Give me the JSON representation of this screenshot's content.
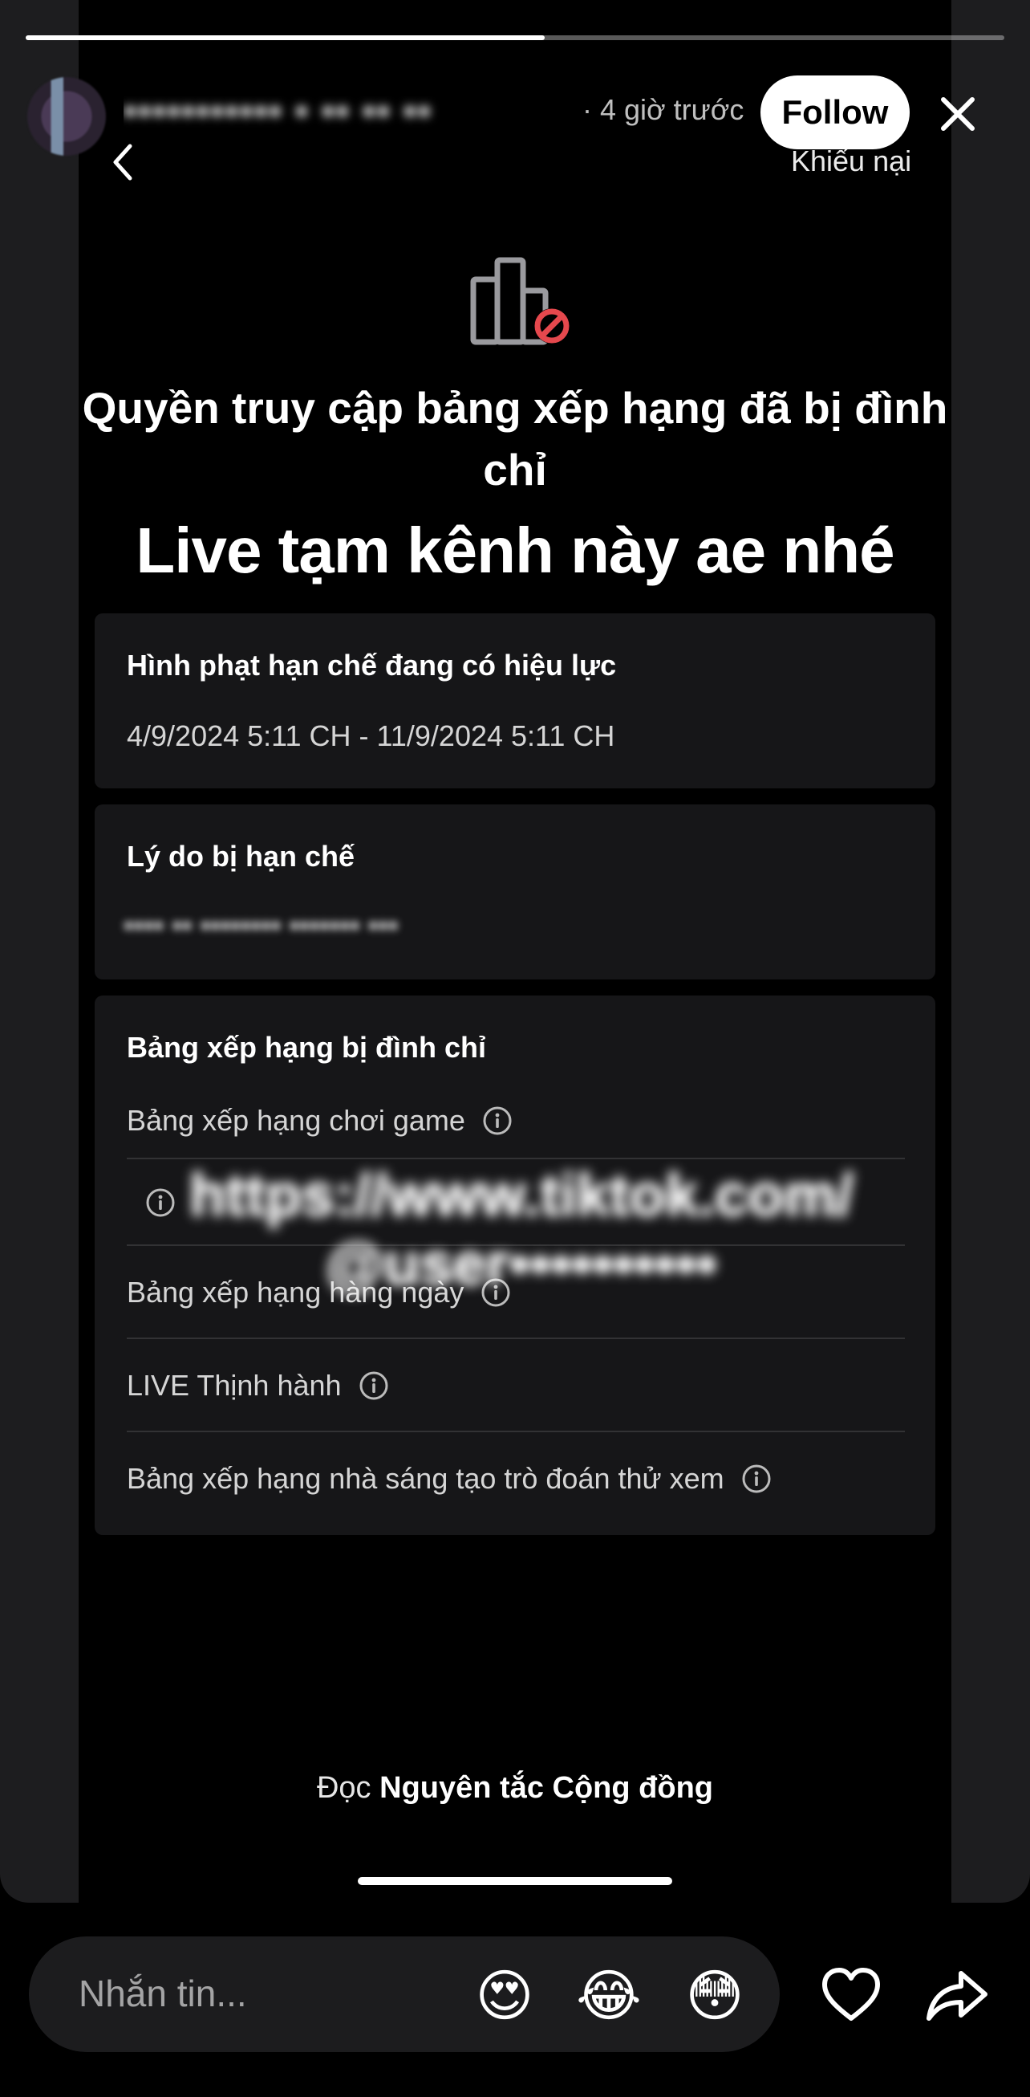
{
  "story": {
    "progress": 0.53,
    "username": "••••••••••• • •• •• ••",
    "time_ago": "· 4 giờ trước",
    "follow_label": "Follow",
    "close_icon": "close-icon"
  },
  "screenshot": {
    "back_icon": "chevron-left-icon",
    "report_label": "Khiếu nại",
    "icon": "leaderboard-banned-icon",
    "headline": "Quyền truy cập bảng xếp hạng đã bị đình chỉ",
    "overlay_text": "Live tạm kênh này ae nhé",
    "penalty": {
      "title": "Hình phạt hạn chế đang có hiệu lực",
      "dates": "4/9/2024 5:11 CH - 11/9/2024 5:11 CH"
    },
    "reason": {
      "title": "Lý do bị hạn chế",
      "text": "•••• •• •••••••• ••••••• •••"
    },
    "suspended": {
      "title": "Bảng xếp hạng bị đình chỉ",
      "items": [
        "Bảng xếp hạng chơi game",
        "",
        "Bảng xếp hạng hàng ngày",
        "LIVE Thịnh hành",
        "Bảng xếp hạng nhà sáng tạo trò đoán thử xem"
      ]
    },
    "sticker_text": [
      "https://www.tiktok.com/",
      "@user••••••••••"
    ],
    "guidelines_prefix": "Đọc",
    "guidelines_link": "Nguyên tắc Cộng đồng"
  },
  "bottom_bar": {
    "message_placeholder": "Nhắn tin...",
    "emoji": [
      "😍",
      "😂",
      "😳"
    ],
    "like_icon": "heart-icon",
    "share_icon": "share-arrow-icon"
  },
  "colors": {
    "danger": "#e5484d",
    "card": "#161618",
    "frame": "#1d1d1f"
  }
}
